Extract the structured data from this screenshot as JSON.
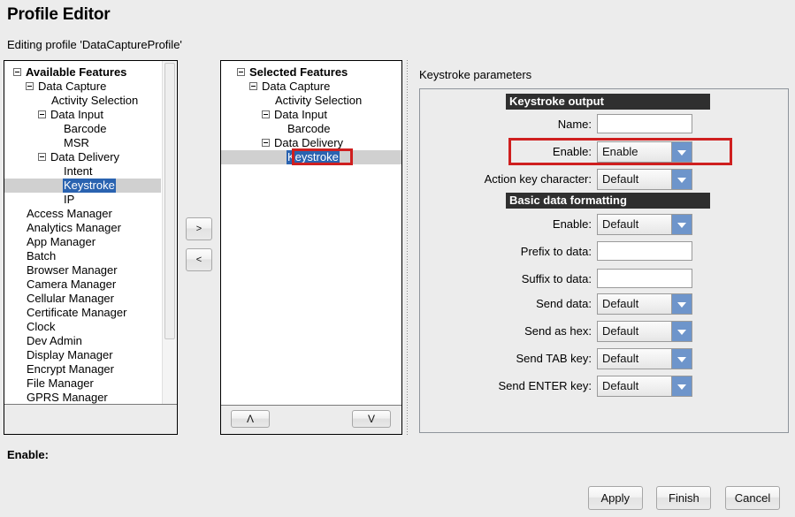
{
  "header": {
    "title": "Profile Editor",
    "editing_line": "Editing profile 'DataCaptureProfile'"
  },
  "available_features": {
    "root_label": "Available Features",
    "items": [
      {
        "label": "Available Features",
        "indent": 0,
        "expander": true,
        "bold": true,
        "selected": false
      },
      {
        "label": "Data Capture",
        "indent": 1,
        "expander": true,
        "bold": false,
        "selected": false
      },
      {
        "label": "Activity Selection",
        "indent": 3,
        "expander": false,
        "bold": false,
        "selected": false
      },
      {
        "label": "Data Input",
        "indent": 2,
        "expander": true,
        "bold": false,
        "selected": false
      },
      {
        "label": "Barcode",
        "indent": 4,
        "expander": false,
        "bold": false,
        "selected": false
      },
      {
        "label": "MSR",
        "indent": 4,
        "expander": false,
        "bold": false,
        "selected": false
      },
      {
        "label": "Data Delivery",
        "indent": 2,
        "expander": true,
        "bold": false,
        "selected": false
      },
      {
        "label": "Intent",
        "indent": 4,
        "expander": false,
        "bold": false,
        "selected": false
      },
      {
        "label": "Keystroke",
        "indent": 4,
        "expander": false,
        "bold": false,
        "selected": true
      },
      {
        "label": "IP",
        "indent": 4,
        "expander": false,
        "bold": false,
        "selected": false
      },
      {
        "label": "Access Manager",
        "indent": 1,
        "expander": false,
        "bold": false,
        "selected": false
      },
      {
        "label": "Analytics Manager",
        "indent": 1,
        "expander": false,
        "bold": false,
        "selected": false
      },
      {
        "label": "App Manager",
        "indent": 1,
        "expander": false,
        "bold": false,
        "selected": false
      },
      {
        "label": "Batch",
        "indent": 1,
        "expander": false,
        "bold": false,
        "selected": false
      },
      {
        "label": "Browser Manager",
        "indent": 1,
        "expander": false,
        "bold": false,
        "selected": false
      },
      {
        "label": "Camera Manager",
        "indent": 1,
        "expander": false,
        "bold": false,
        "selected": false
      },
      {
        "label": "Cellular Manager",
        "indent": 1,
        "expander": false,
        "bold": false,
        "selected": false
      },
      {
        "label": "Certificate Manager",
        "indent": 1,
        "expander": false,
        "bold": false,
        "selected": false
      },
      {
        "label": "Clock",
        "indent": 1,
        "expander": false,
        "bold": false,
        "selected": false
      },
      {
        "label": "Dev Admin",
        "indent": 1,
        "expander": false,
        "bold": false,
        "selected": false
      },
      {
        "label": "Display Manager",
        "indent": 1,
        "expander": false,
        "bold": false,
        "selected": false
      },
      {
        "label": "Encrypt Manager",
        "indent": 1,
        "expander": false,
        "bold": false,
        "selected": false
      },
      {
        "label": "File Manager",
        "indent": 1,
        "expander": false,
        "bold": false,
        "selected": false
      },
      {
        "label": "GPRS Manager",
        "indent": 1,
        "expander": false,
        "bold": false,
        "selected": false
      }
    ]
  },
  "transfer": {
    "add_label": ">",
    "remove_label": "<"
  },
  "selected_features": {
    "items": [
      {
        "label": "Selected Features",
        "indent": 0,
        "expander": true,
        "bold": true,
        "selected": false
      },
      {
        "label": "Data Capture",
        "indent": 1,
        "expander": true,
        "bold": false,
        "selected": false
      },
      {
        "label": "Activity Selection",
        "indent": 3,
        "expander": false,
        "bold": false,
        "selected": false
      },
      {
        "label": "Data Input",
        "indent": 2,
        "expander": true,
        "bold": false,
        "selected": false
      },
      {
        "label": "Barcode",
        "indent": 4,
        "expander": false,
        "bold": false,
        "selected": false
      },
      {
        "label": "Data Delivery",
        "indent": 2,
        "expander": true,
        "bold": false,
        "selected": false
      },
      {
        "label": "Keystroke",
        "indent": 4,
        "expander": false,
        "bold": false,
        "selected": true
      }
    ],
    "move_up_label": "Λ",
    "move_down_label": "V"
  },
  "params": {
    "panel_title": "Keystroke parameters",
    "sections": [
      {
        "title": "Keystroke output"
      },
      {
        "title": "Basic data formatting"
      }
    ],
    "fields": [
      {
        "label": "Name:",
        "type": "text",
        "value": "",
        "placeholder": ""
      },
      {
        "label": "Enable:",
        "type": "select",
        "value": "Enable",
        "highlighted": true
      },
      {
        "label": "Action key character:",
        "type": "select",
        "value": "Default",
        "highlighted": false
      },
      {
        "label": "Enable:",
        "type": "select",
        "value": "Default",
        "highlighted": false
      },
      {
        "label": "Prefix to data:",
        "type": "text",
        "value": "",
        "placeholder": ""
      },
      {
        "label": "Suffix to data:",
        "type": "text",
        "value": "",
        "placeholder": ""
      },
      {
        "label": "Send data:",
        "type": "select",
        "value": "Default",
        "highlighted": false
      },
      {
        "label": "Send as hex:",
        "type": "select",
        "value": "Default",
        "highlighted": false
      },
      {
        "label": "Send TAB key:",
        "type": "select",
        "value": "Default",
        "highlighted": false
      },
      {
        "label": "Send ENTER key:",
        "type": "select",
        "value": "Default",
        "highlighted": false
      }
    ]
  },
  "footer": {
    "enable_label": "Enable:",
    "apply_label": "Apply",
    "finish_label": "Finish",
    "cancel_label": "Cancel"
  },
  "colors": {
    "highlight_red": "#cf1f1f",
    "selection_blue": "#2a63b0",
    "dropdown_blue": "#6e95cb",
    "section_bar": "#2f2f2f",
    "window_bg": "#ececec"
  }
}
